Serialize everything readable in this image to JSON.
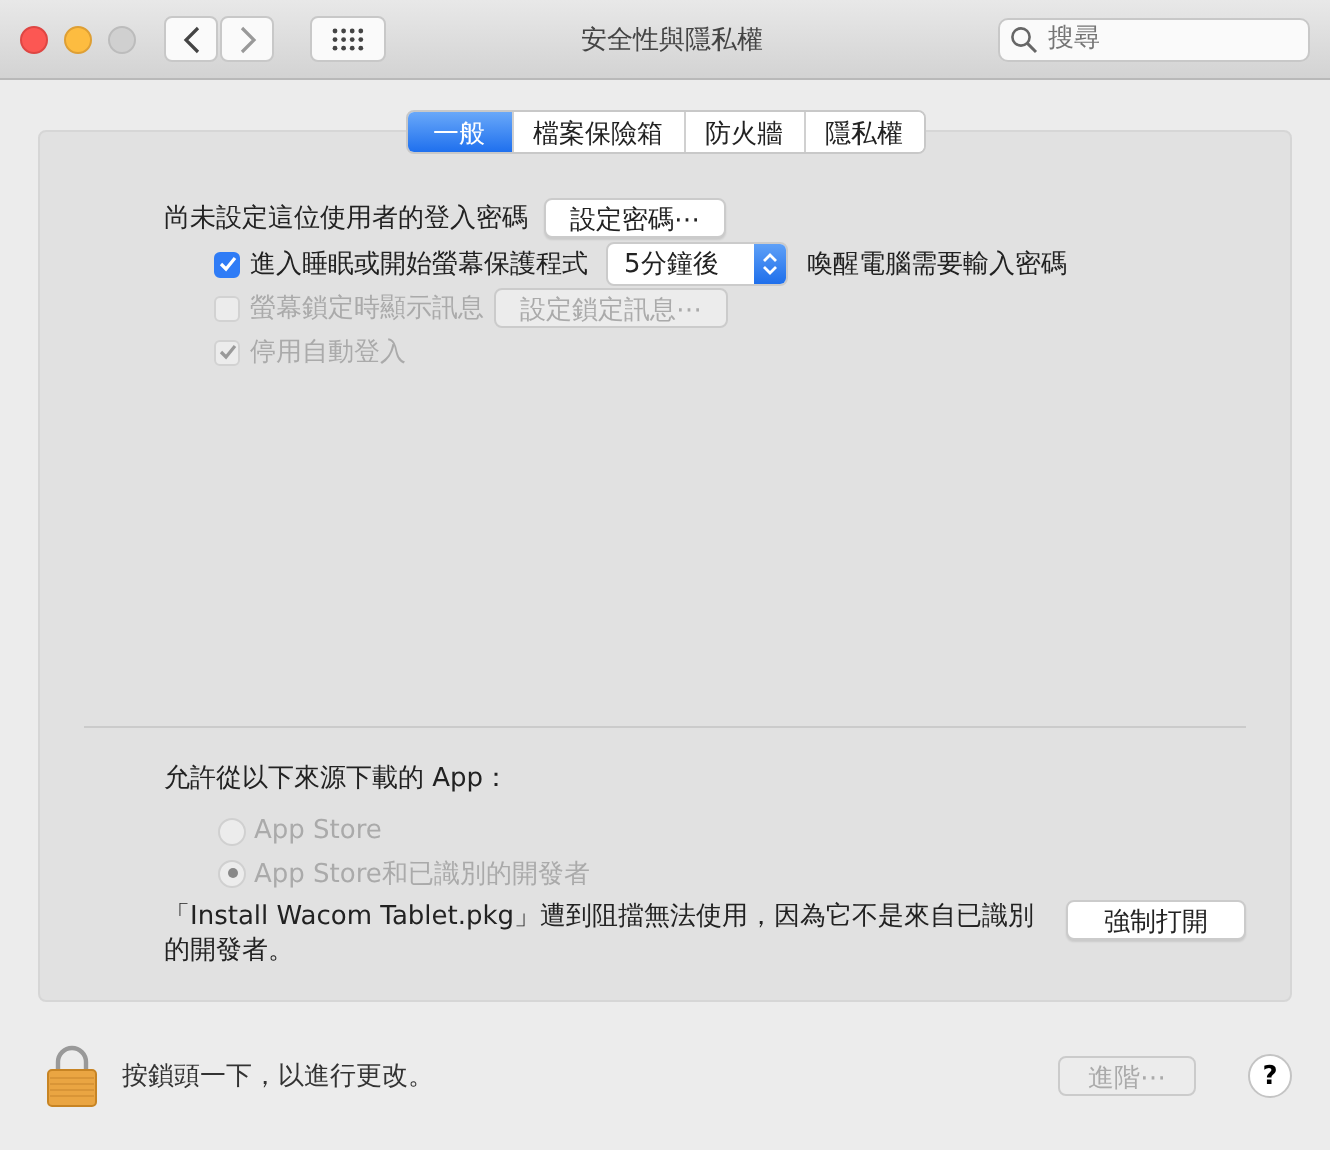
{
  "window": {
    "title": "安全性與隱私權"
  },
  "search": {
    "placeholder": "搜尋"
  },
  "tabs": [
    {
      "label": "一般",
      "selected": true
    },
    {
      "label": "檔案保險箱",
      "selected": false
    },
    {
      "label": "防火牆",
      "selected": false
    },
    {
      "label": "隱私權",
      "selected": false
    }
  ],
  "password": {
    "label": "尚未設定這位使用者的登入密碼",
    "button": "設定密碼⋯"
  },
  "options": [
    {
      "kind": "select",
      "label": "進入睡眠或開始螢幕保護程式",
      "checked": true,
      "disabled": false,
      "value": "5分鐘後",
      "suffix": "喚醒電腦需要輸入密碼"
    },
    {
      "kind": "button",
      "label": "螢幕鎖定時顯示訊息",
      "checked": false,
      "disabled": true,
      "button": "設定鎖定訊息⋯"
    },
    {
      "kind": "plain",
      "label": "停用自動登入",
      "checked": true,
      "disabled": true
    }
  ],
  "downloads": {
    "heading": "允許從以下來源下載的 App：",
    "sources": [
      {
        "label": "App Store",
        "selected": false,
        "disabled": true
      },
      {
        "label": "App Store和已識別的開發者",
        "selected": true,
        "disabled": true
      }
    ],
    "message": "「Install Wacom Tablet.pkg」遭到阻擋無法使用，因為它不是來自已識別的開發者。",
    "button": "強制打開"
  },
  "footer": {
    "lock_text": "按鎖頭一下，以進行更改。",
    "advanced": {
      "label": "進階⋯",
      "disabled": true
    },
    "help": "?"
  }
}
